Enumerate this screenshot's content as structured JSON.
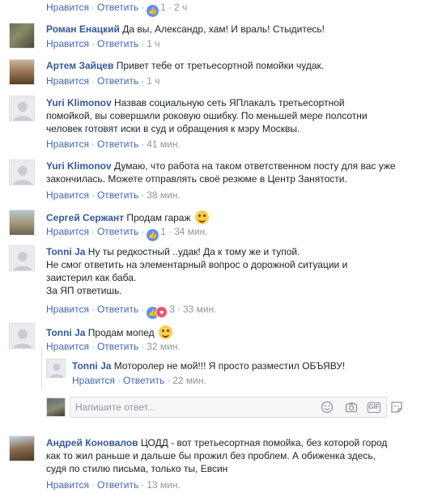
{
  "labels": {
    "like": "Нравится",
    "reply": "Ответить",
    "dot": "·"
  },
  "comments": [
    {
      "author": "",
      "text": "",
      "likes": "1",
      "time": "2 ч"
    },
    {
      "author": "Роман Енацкий",
      "text": "Да вы, Александр, хам! И враль! Стыдитесь!",
      "time": "1 ч"
    },
    {
      "author": "Артем Зайцев",
      "text": "Привет тебе от третьесортной помойки чудак.",
      "time": "1 ч"
    },
    {
      "author": "Yuri Klimonov",
      "text": "Назвав социальную сеть ЯПлакалъ третьесортной помойкой, вы совершили роковую ошибку. По меньшей мере полсотни человек готовят иски в суд и обращения к мэру Москвы.",
      "time": "41 мин."
    },
    {
      "author": "Yuri Klimonov",
      "text": "Думаю, что работа на таком ответственном посту для вас уже закончилась. Можете отправлять своё резюме в Центр Занятости.",
      "time": "38 мин."
    },
    {
      "author": "Сергей Сержант",
      "text": "Продам гараж",
      "likes": "1",
      "time": "34 мин."
    },
    {
      "author": "Tonni Ja",
      "text_lines": [
        "Ну ты редкостный ..удак! Да к тому же и тупой.",
        "Не смог ответить на элементарный вопрос о дорожной ситуации и",
        "заистерил как баба.",
        "За ЯП ответишь."
      ],
      "likes": "3",
      "time": "33 мин."
    },
    {
      "author": "Tonni Ja",
      "text": "Продам мопед",
      "time": "32 мин."
    },
    {
      "author": "Tonni Ja",
      "text": "Моторолер не мой!!! Я просто разместил ОБЪЯВУ!",
      "time": "22 мин."
    },
    {
      "author": "Андрей Коновалов",
      "text_lines": [
        "ЦОДД - вот третьесортная помойка, без которой город",
        "как то жил раньше и дальше бы прожил без проблем. А обиженка здесь,",
        "судя по стилю письма, только ты, Евсин"
      ],
      "time": "13 мин."
    }
  ],
  "reply_box": {
    "placeholder": "Напишите ответ..."
  },
  "icons": {
    "like_reaction": "thumbs-up-icon",
    "love_reaction": "heart-icon",
    "emoji": "smile-icon",
    "camera": "camera-icon",
    "gif": "GIF",
    "sticker": "sticker-icon"
  },
  "colors": {
    "author": "#365899",
    "link": "#4267b2",
    "meta": "#90949c",
    "like_badge": "#5890ff",
    "love_badge": "#f25268"
  }
}
